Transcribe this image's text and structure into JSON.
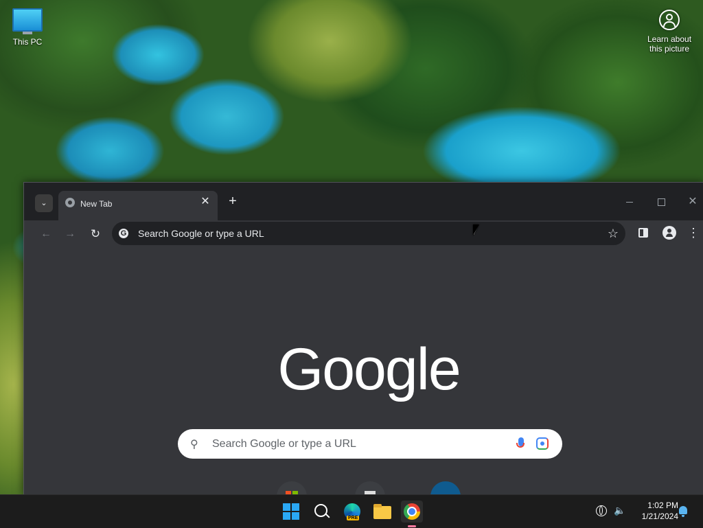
{
  "desktop": {
    "icons": [
      {
        "label": "This PC"
      },
      {
        "label": "Learn about\nthis picture"
      }
    ]
  },
  "browser": {
    "tab": {
      "title": "New Tab"
    },
    "new_tab_glyph": "+",
    "omnibox": {
      "placeholder": "Search Google or type a URL"
    },
    "ntp": {
      "logo": "Google",
      "search_placeholder": "Search Google or type a URL"
    }
  },
  "taskbar": {
    "edge_badge": "PRE",
    "clock": {
      "time": "1:02 PM",
      "date": "1/21/2024"
    }
  }
}
